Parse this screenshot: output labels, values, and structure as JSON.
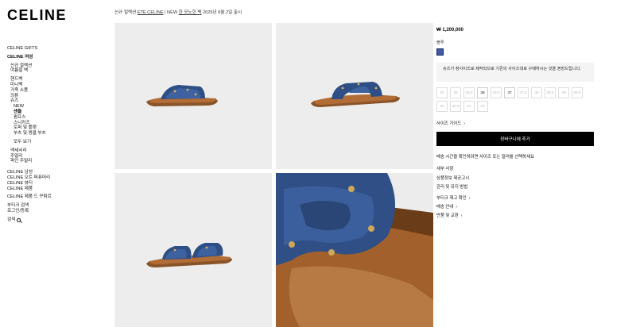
{
  "brand": {
    "logo": "CELINE"
  },
  "announcement": {
    "prefix": "신규 컬렉션 ",
    "link1": "ÉTÉ CELINE",
    "middle": " | NEW ",
    "link2": "한 모노힌 백",
    "suffix": " 2025년 6월 2일 출시"
  },
  "sidebar": {
    "gifts": "CELINE GIFTS",
    "women": "CELINE 여성",
    "new_collection": "신규 컬렉션",
    "summer_collection": "여름철 백",
    "handbags": "핸드백",
    "mini_bags": "미니백",
    "leather_goods": "가죽 소품",
    "shoes_l": "의류",
    "shoes": "슈즈",
    "shoes_new": "NEW",
    "sandals": "샌들",
    "pumps": "펌프스",
    "sneakers": "스니커즈",
    "loafers": "로퍼 및 플랫",
    "boots": "부츠 및 앵클 부츠",
    "view_all": "모두 보기",
    "accessories": "액세서리",
    "jewelry": "주얼리",
    "fine_jewelry": "파인 주얼리",
    "men": "CELINE 남성",
    "perfume": "CELINE 오트 퍼퓨머리",
    "beaute": "CELINE 뷰티",
    "services": "CELINE 제품",
    "services2": "CELINE 제품 드 꾸튀르",
    "boutique": "부티크 검색",
    "login": "로그인/등록",
    "search": "검색"
  },
  "product": {
    "price": "₩ 1,200,000",
    "color_label": "블루",
    "swatch_color": "#3f5aa3",
    "notice": "슈즈가 정사이즈로 제작되므로 기존의 사이즈대로 구매하시는 것을 권장드립니다.",
    "sizes": [
      {
        "label": "34",
        "available": false
      },
      {
        "label": "35",
        "available": false
      },
      {
        "label": "35.5",
        "available": false
      },
      {
        "label": "36",
        "available": true
      },
      {
        "label": "36.5",
        "available": false
      },
      {
        "label": "37",
        "available": true
      },
      {
        "label": "37.5",
        "available": false
      },
      {
        "label": "38",
        "available": false
      },
      {
        "label": "38.5",
        "available": false
      },
      {
        "label": "39",
        "available": false
      },
      {
        "label": "39.5",
        "available": false
      },
      {
        "label": "40",
        "available": false
      },
      {
        "label": "40.5",
        "available": false
      },
      {
        "label": "41",
        "available": false
      },
      {
        "label": "42",
        "available": false
      }
    ],
    "size_guide": "사이즈 가이드",
    "add_to_cart": "장바구니에 추가",
    "cart_hint": "배송 시간을 확인하려면 사이즈 또는 컬러를 선택하세요",
    "details": "세부 사항",
    "product_info": "상품정보 제공고시",
    "care": "관리 및 유지 방법",
    "stock": "부티크 재고 확인",
    "delivery": "배송 안내",
    "returns": "반품 및 교환"
  }
}
